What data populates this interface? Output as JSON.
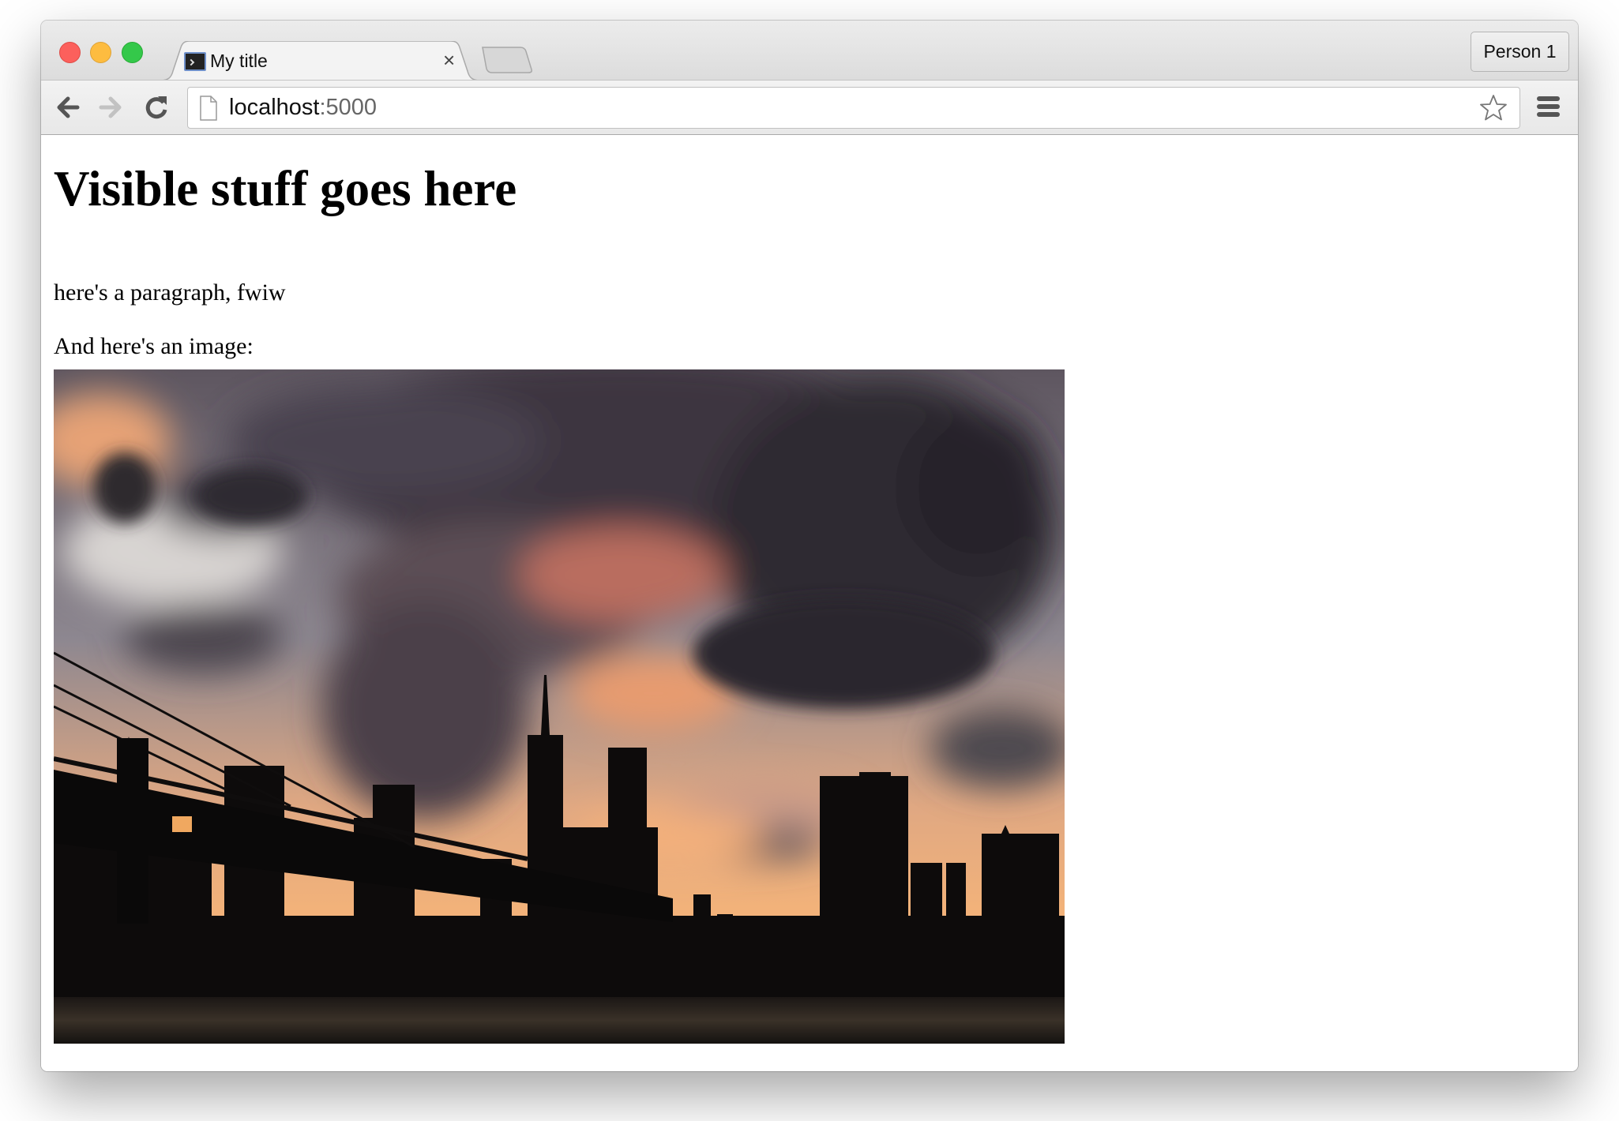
{
  "browser": {
    "tab": {
      "title": "My title",
      "close_icon": "×",
      "favicon": "terminal-icon"
    },
    "profile_button": "Person 1",
    "address_bar": {
      "host": "localhost",
      "port": ":5000"
    },
    "traffic_lights": {
      "close": "#fc605c",
      "minimize": "#fdbc40",
      "maximize": "#34c84a"
    }
  },
  "page": {
    "heading": "Visible stuff goes here",
    "paragraph": "here's a paragraph, fwiw",
    "image_caption": "And here's an image:",
    "image": "city skyline silhouette at sunset under dramatic clouds with suspension bridge"
  }
}
